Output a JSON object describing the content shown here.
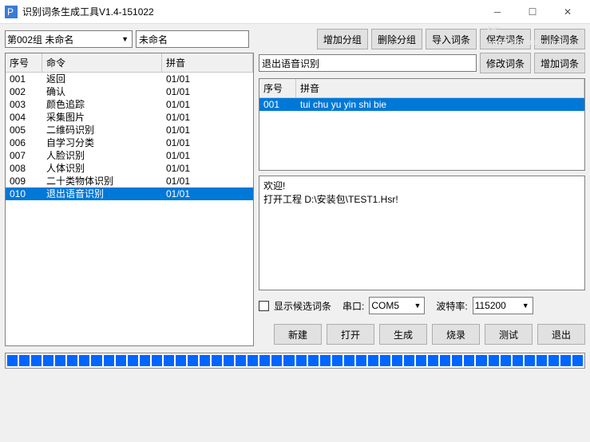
{
  "window": {
    "title": "识别词条生成工具V1.4-151022"
  },
  "watermark": {
    "big": "DF",
    "small": "www.DFRobot.com.cn"
  },
  "groupSelect": "第002组 未命名",
  "groupName": "未命名",
  "topButtons": {
    "addGroup": "增加分组",
    "delGroup": "删除分组",
    "importEntry": "导入词条",
    "saveEntry": "保存词条",
    "delEntry": "删除词条"
  },
  "leftTable": {
    "headers": {
      "c1": "序号",
      "c2": "命令",
      "c3": "拼音"
    },
    "rows": [
      {
        "c1": "001",
        "c2": "返回",
        "c3": "01/01"
      },
      {
        "c1": "002",
        "c2": "确认",
        "c3": "01/01"
      },
      {
        "c1": "003",
        "c2": "颜色追踪",
        "c3": "01/01"
      },
      {
        "c1": "004",
        "c2": "采集图片",
        "c3": "01/01"
      },
      {
        "c1": "005",
        "c2": "二维码识别",
        "c3": "01/01"
      },
      {
        "c1": "006",
        "c2": "自学习分类",
        "c3": "01/01"
      },
      {
        "c1": "007",
        "c2": "人脸识别",
        "c3": "01/01"
      },
      {
        "c1": "008",
        "c2": "人体识别",
        "c3": "01/01"
      },
      {
        "c1": "009",
        "c2": "二十类物体识别",
        "c3": "01/01"
      },
      {
        "c1": "010",
        "c2": "退出语音识别",
        "c3": "01/01",
        "selected": true
      }
    ]
  },
  "entryInput": "退出语音识别",
  "entryButtons": {
    "modify": "修改词条",
    "add": "增加词条"
  },
  "pinyinTable": {
    "headers": {
      "c1": "序号",
      "c2": "拼音"
    },
    "rows": [
      {
        "c1": "001",
        "c2": "tui chu yu yin shi bie",
        "selected": true
      }
    ]
  },
  "log": "欢迎!\n打开工程 D:\\安装包\\TEST1.Hsr!",
  "options": {
    "showCandidateLabel": "显示候选词条",
    "serialLabel": "串口:",
    "serialValue": "COM5",
    "baudLabel": "波特率:",
    "baudValue": "115200"
  },
  "bottomButtons": {
    "new": "新建",
    "open": "打开",
    "gen": "生成",
    "burn": "烧录",
    "test": "测试",
    "exit": "退出"
  }
}
